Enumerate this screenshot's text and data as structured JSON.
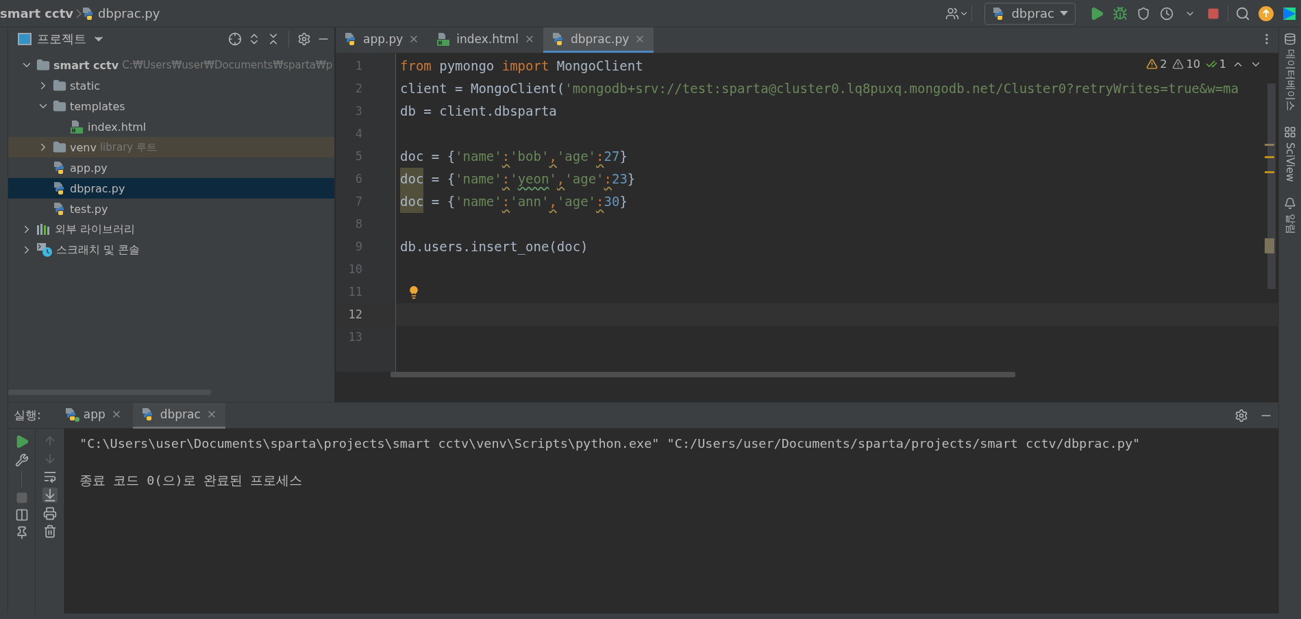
{
  "breadcrumb": [
    {
      "label": "smart cctv",
      "kind": "project"
    },
    {
      "label": "dbprac.py",
      "kind": "python"
    }
  ],
  "run_config": {
    "label": "dbprac"
  },
  "project_panel": {
    "title": "프로젝트",
    "tree": [
      {
        "label": "smart cctv",
        "path": "C:₩Users₩user₩Documents₩sparta₩p",
        "kind": "folder",
        "expanded": true,
        "selected": false,
        "children": [
          {
            "label": "static",
            "kind": "folder",
            "expanded": false,
            "selected": false
          },
          {
            "label": "templates",
            "kind": "folder",
            "expanded": true,
            "selected": false,
            "children": [
              {
                "label": "index.html",
                "kind": "html",
                "selected": false
              }
            ]
          },
          {
            "label": "venv",
            "hint": "library 루트",
            "kind": "library-folder",
            "expanded": false,
            "selected": false
          },
          {
            "label": "app.py",
            "kind": "python",
            "selected": false
          },
          {
            "label": "dbprac.py",
            "kind": "python",
            "selected": true
          },
          {
            "label": "test.py",
            "kind": "python",
            "selected": false
          }
        ]
      },
      {
        "label": "외부 라이브러리",
        "kind": "libraries",
        "expanded": false,
        "selected": false
      },
      {
        "label": "스크래치 및 콘솔",
        "kind": "scratches",
        "expanded": false,
        "selected": false
      }
    ]
  },
  "editor": {
    "tabs": [
      {
        "label": "app.py",
        "kind": "python",
        "selected": false
      },
      {
        "label": "index.html",
        "kind": "html",
        "selected": false
      },
      {
        "label": "dbprac.py",
        "kind": "python",
        "selected": true
      }
    ],
    "inspections": [
      {
        "count": "2",
        "kind": "warning"
      },
      {
        "count": "10",
        "kind": "weak"
      },
      {
        "count": "1",
        "kind": "ok"
      }
    ],
    "lines": [
      {
        "number": "1",
        "current": false,
        "bulb": false,
        "tokens": [
          {
            "text": "from",
            "kind": "keyword"
          },
          {
            "text": " pymongo ",
            "kind": "plain"
          },
          {
            "text": "import",
            "kind": "keyword"
          },
          {
            "text": " MongoClient",
            "kind": "plain"
          }
        ]
      },
      {
        "number": "2",
        "current": false,
        "bulb": false,
        "tokens": [
          {
            "text": "client = MongoClient(",
            "kind": "plain"
          },
          {
            "text": "'mongodb+srv://test:sparta@cluster0.lq8puxq.mongodb.net/Cluster0?retryWrites=true&w=ma",
            "kind": "string"
          }
        ]
      },
      {
        "number": "3",
        "current": false,
        "bulb": false,
        "tokens": [
          {
            "text": "db = client.dbsparta",
            "kind": "plain"
          }
        ]
      },
      {
        "number": "4",
        "current": false,
        "bulb": false
      },
      {
        "number": "5",
        "current": false,
        "bulb": false,
        "tokens": [
          {
            "text": "doc = {",
            "kind": "plain"
          },
          {
            "text": "'name'",
            "kind": "string"
          },
          {
            "text": ":",
            "kind": "weak"
          },
          {
            "text": "'bob'",
            "kind": "string"
          },
          {
            "text": ",",
            "kind": "weak"
          },
          {
            "text": "'age'",
            "kind": "string"
          },
          {
            "text": ":",
            "kind": "weak"
          },
          {
            "text": "27",
            "kind": "number"
          },
          {
            "text": "}",
            "kind": "plain"
          }
        ]
      },
      {
        "number": "6",
        "current": false,
        "bulb": false,
        "tokens": [
          {
            "text": "doc",
            "kind": "usage"
          },
          {
            "text": " = {",
            "kind": "plain"
          },
          {
            "text": "'name'",
            "kind": "string"
          },
          {
            "text": ":",
            "kind": "weak"
          },
          {
            "text": "'",
            "kind": "string"
          },
          {
            "text": "yeon",
            "kind": "typo"
          },
          {
            "text": "'",
            "kind": "string"
          },
          {
            "text": ",",
            "kind": "weak"
          },
          {
            "text": "'age'",
            "kind": "string"
          },
          {
            "text": ":",
            "kind": "weak"
          },
          {
            "text": "23",
            "kind": "number"
          },
          {
            "text": "}",
            "kind": "plain"
          }
        ]
      },
      {
        "number": "7",
        "current": false,
        "bulb": false,
        "tokens": [
          {
            "text": "doc",
            "kind": "usage"
          },
          {
            "text": " = {",
            "kind": "plain"
          },
          {
            "text": "'name'",
            "kind": "string"
          },
          {
            "text": ":",
            "kind": "weak"
          },
          {
            "text": "'ann'",
            "kind": "string"
          },
          {
            "text": ",",
            "kind": "weak"
          },
          {
            "text": "'age'",
            "kind": "string"
          },
          {
            "text": ":",
            "kind": "weak"
          },
          {
            "text": "30",
            "kind": "number"
          },
          {
            "text": "}",
            "kind": "plain"
          }
        ]
      },
      {
        "number": "8",
        "current": false,
        "bulb": false
      },
      {
        "number": "9",
        "current": false,
        "bulb": false,
        "tokens": [
          {
            "text": "db.users.insert_one(doc)",
            "kind": "plain"
          }
        ]
      },
      {
        "number": "10",
        "current": false,
        "bulb": false
      },
      {
        "number": "11",
        "current": false,
        "bulb": true
      },
      {
        "number": "12",
        "current": true,
        "bulb": false
      },
      {
        "number": "13",
        "current": false,
        "bulb": false
      }
    ]
  },
  "run_panel": {
    "title": "실행:",
    "tabs": [
      {
        "label": "app",
        "running": true,
        "selected": false
      },
      {
        "label": "dbprac",
        "running": false,
        "selected": true
      }
    ],
    "console": [
      {
        "text": "\"C:\\Users\\user\\Documents\\sparta\\projects\\smart cctv\\venv\\Scripts\\python.exe\" \"C:/Users/user/Documents/sparta/projects/smart cctv/dbprac.py\""
      },
      {
        "text": "종료 코드 0(으)로 완료된 프로세스"
      }
    ]
  },
  "right_stripe": [
    {
      "label": "데이터베이스",
      "kind": "database"
    },
    {
      "label": "SciView",
      "kind": "grid"
    },
    {
      "label": "알림",
      "kind": "bell"
    }
  ]
}
